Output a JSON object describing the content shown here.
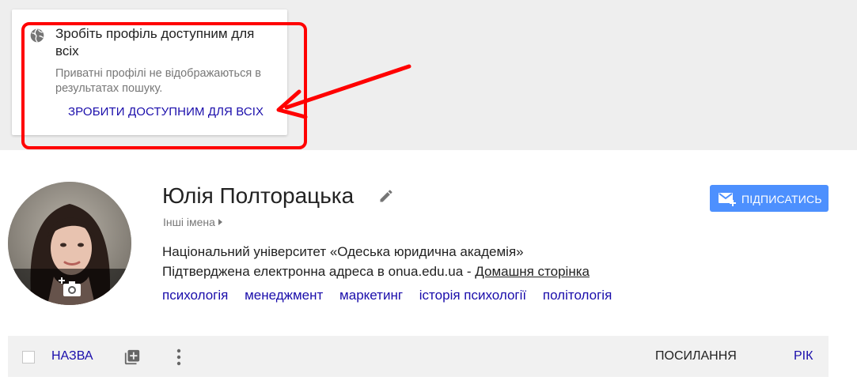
{
  "visibility_card": {
    "title": "Зробіть профіль доступним для всіх",
    "description": "Приватні профілі не відображаються в результатах пошуку.",
    "action_label": "ЗРОБИТИ ДОСТУПНИМ ДЛЯ ВСІХ"
  },
  "profile": {
    "name": "Юлія Полторацька",
    "other_names": "Інші імена",
    "affiliation": "Національний університет «Одеська юридична академія»",
    "email_text": "Підтверджена електронна адреса в onua.edu.ua - ",
    "homepage_label": "Домашня сторінка",
    "interests": [
      "психологія",
      "менеджмент",
      "маркетинг",
      "історія психології",
      "політологія"
    ]
  },
  "follow_button": {
    "label": "ПІДПИСАТИСЬ"
  },
  "table_header": {
    "title_label": "НАЗВА",
    "cited_label": "ПОСИЛАННЯ",
    "year_label": "РІК"
  },
  "colors": {
    "link": "#1a0dab",
    "accent_button": "#4d90fe",
    "annotation": "#ff0000"
  },
  "icons": [
    "globe-icon",
    "edit-pencil-icon",
    "add-photo-icon",
    "mail-plus-icon",
    "add-box-icon",
    "more-vert-icon",
    "annotation-arrow"
  ]
}
